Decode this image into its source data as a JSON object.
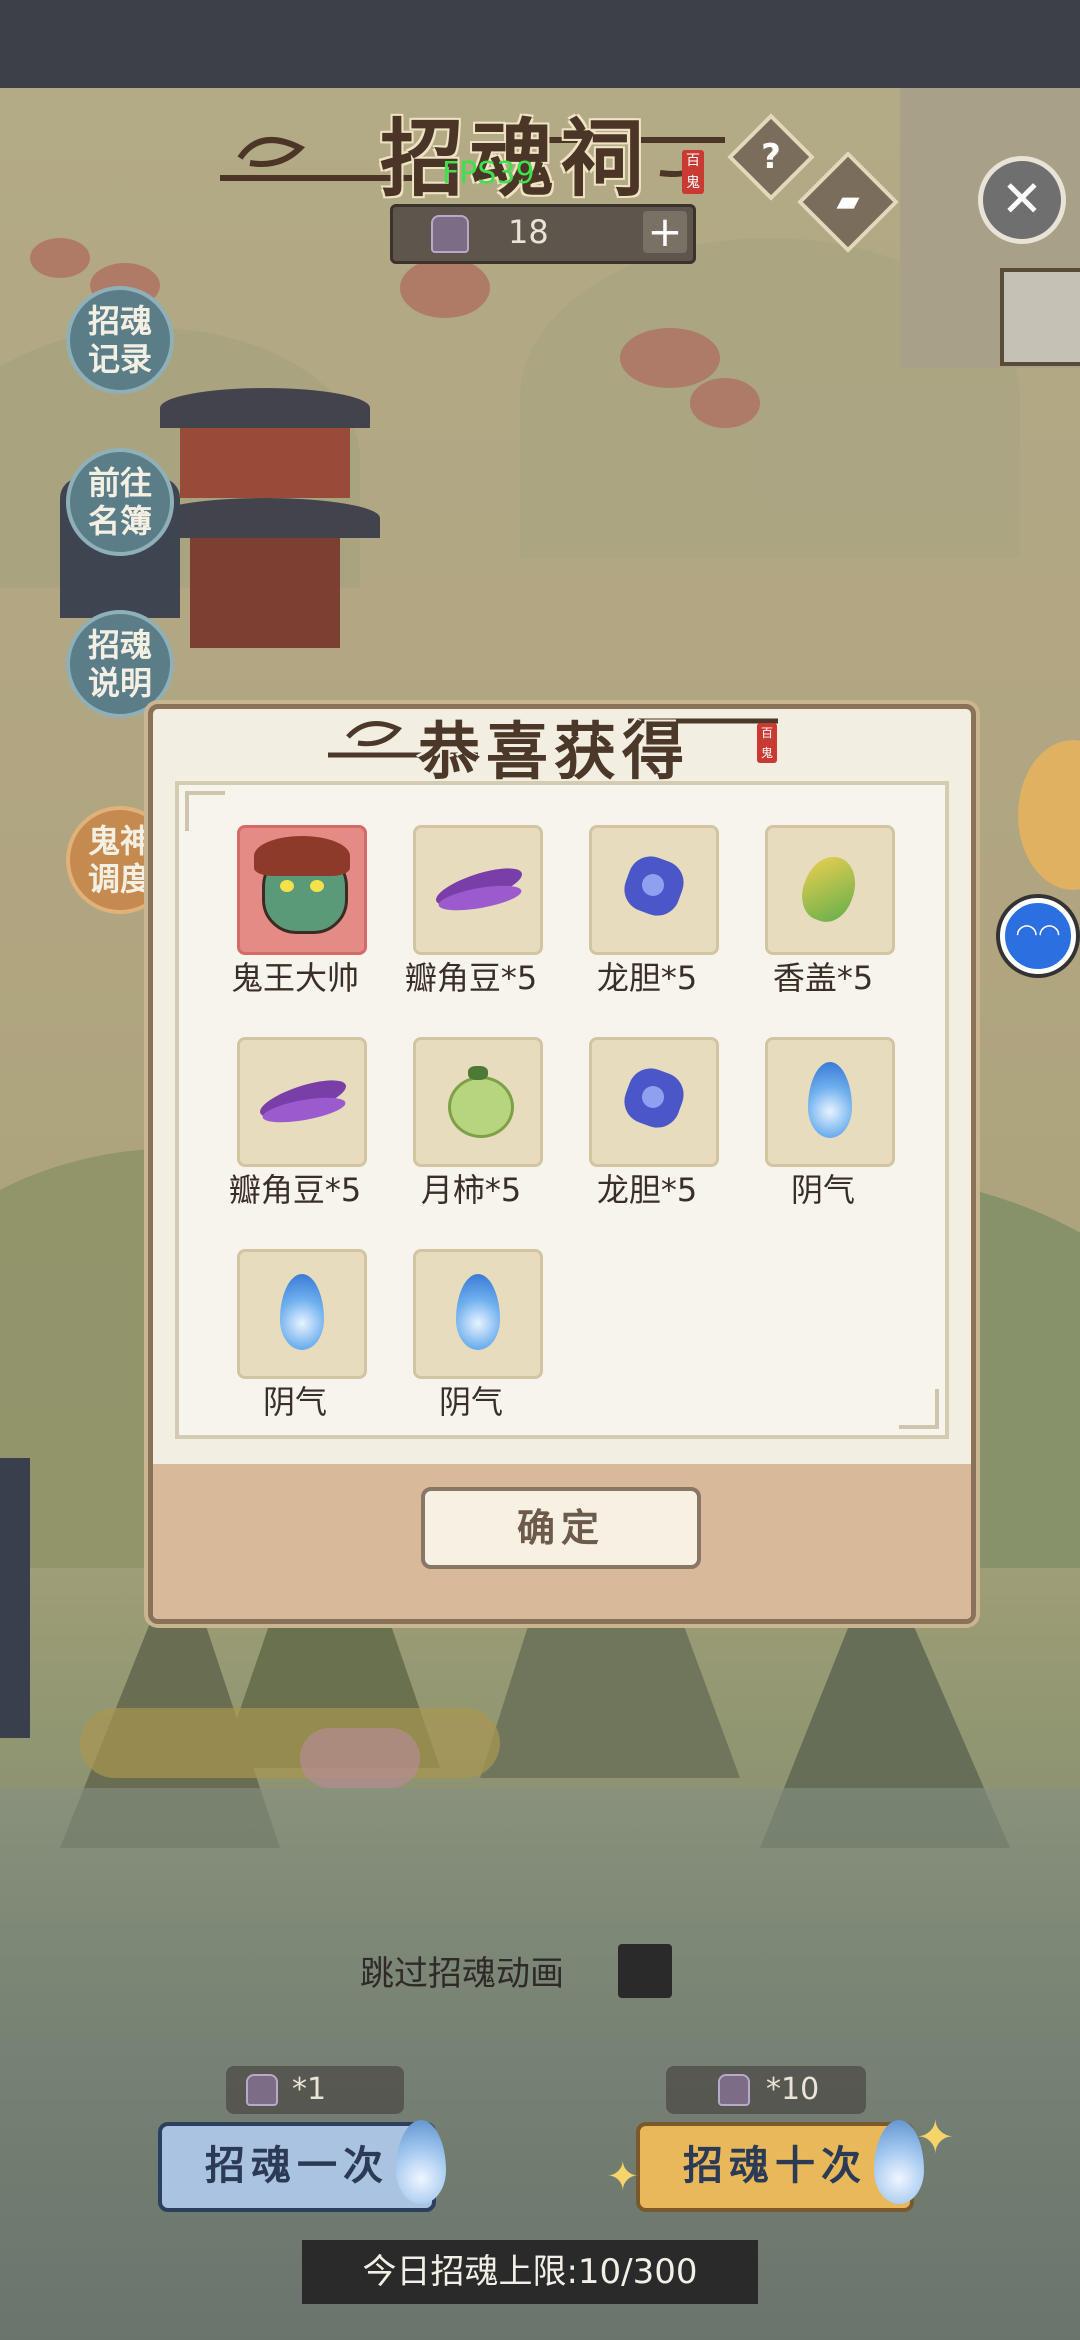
{
  "header": {
    "title": "招魂祠",
    "title_seal": "百鬼",
    "fps": "FPS39",
    "currency_value": "18",
    "help_icon": "question-icon",
    "close_icon": "close-icon"
  },
  "side_menu": [
    {
      "label": "招魂记录"
    },
    {
      "label": "前往名簿"
    },
    {
      "label": "招魂说明"
    },
    {
      "label": "鬼神调度"
    }
  ],
  "dialog": {
    "title": "恭喜获得",
    "title_seal": "百鬼",
    "items": [
      {
        "label": "鬼王大帅",
        "icon": "ghost-king-portrait",
        "highlight": true
      },
      {
        "label": "瓣角豆*5",
        "icon": "purple-bean-icon"
      },
      {
        "label": "龙胆*5",
        "icon": "blue-flower-icon"
      },
      {
        "label": "香盖*5",
        "icon": "mango-icon"
      },
      {
        "label": "瓣角豆*5",
        "icon": "purple-bean-icon"
      },
      {
        "label": "月柿*5",
        "icon": "green-persimmon-icon"
      },
      {
        "label": "龙胆*5",
        "icon": "blue-flower-icon"
      },
      {
        "label": "阴气",
        "icon": "blue-flame-icon"
      },
      {
        "label": "阴气",
        "icon": "blue-flame-icon"
      },
      {
        "label": "阴气",
        "icon": "blue-flame-icon"
      }
    ],
    "confirm_label": "确定"
  },
  "bottom": {
    "skip_label": "跳过招魂动画",
    "summon_once": {
      "label": "招魂一次",
      "cost": "*1"
    },
    "summon_ten": {
      "label": "招魂十次",
      "cost": "*10"
    },
    "daily_limit": "今日招魂上限:10/300"
  },
  "colors": {
    "dialog_border": "#8a7258",
    "summon_once_bg": "#a9c3e0",
    "summon_ten_bg": "#e8b85a",
    "fps_green": "#3fe04a"
  }
}
